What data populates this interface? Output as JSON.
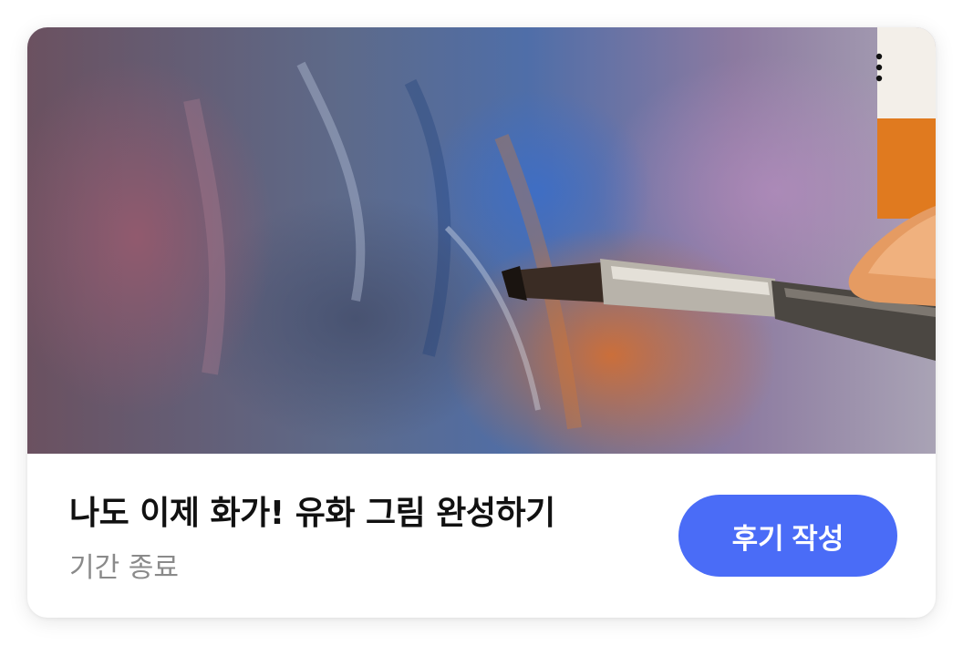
{
  "card": {
    "image_alt": "유화 붓으로 캔버스에 그림을 그리는 모습",
    "menu_icon": "more-vertical-icon",
    "title": "나도 이제 화가! 유화 그림 완성하기",
    "status": "기간 종료",
    "review_button_label": "후기 작성"
  },
  "colors": {
    "accent": "#4a6cf7",
    "title": "#111111",
    "status": "#8a8a8a"
  }
}
